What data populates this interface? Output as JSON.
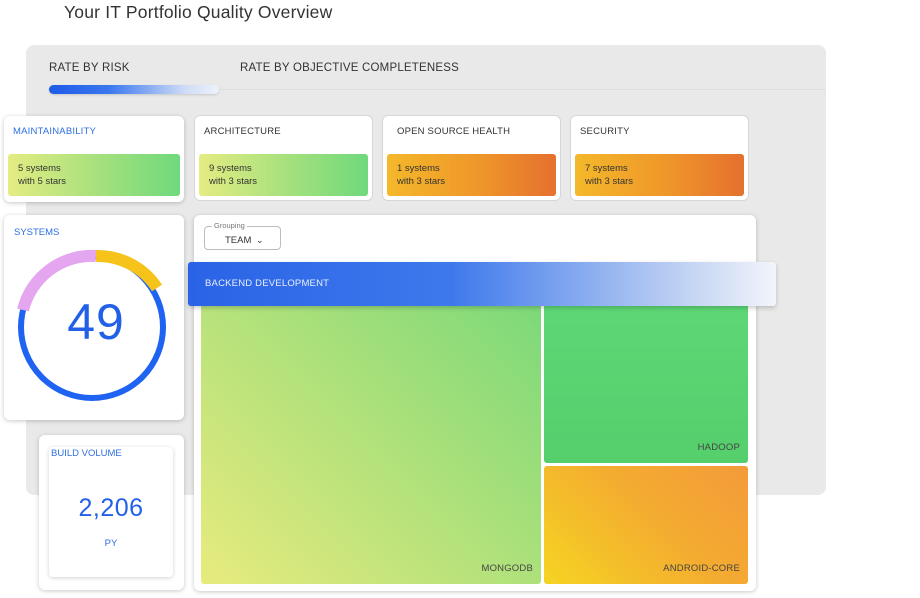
{
  "page_title": "Your IT Portfolio Quality Overview",
  "tabs": [
    {
      "label": "RATE BY RISK",
      "active": true
    },
    {
      "label": "RATE BY OBJECTIVE COMPLETENESS",
      "active": false
    }
  ],
  "categories": [
    {
      "title": "MAINTAINABILITY",
      "line1": "5 systems",
      "line2": "with 5 stars",
      "tone": "green"
    },
    {
      "title": "ARCHITECTURE",
      "line1": "9 systems",
      "line2": "with 3 stars",
      "tone": "green"
    },
    {
      "title": "OPEN SOURCE HEALTH",
      "line1": "1 systems",
      "line2": "with 3 stars",
      "tone": "orange"
    },
    {
      "title": "SECURITY",
      "line1": "7 systems",
      "line2": "with 3 stars",
      "tone": "orange"
    }
  ],
  "systems": {
    "label": "SYSTEMS",
    "count": "49",
    "gauge_colors": {
      "track": "#1f63f2",
      "segment_pink": "#e4a6ef",
      "segment_yellow": "#f5c31a"
    }
  },
  "build_volume": {
    "label": "BUILD VOLUME",
    "value": "2,206",
    "unit": "PY"
  },
  "grouping": {
    "legend": "Grouping",
    "value": "TEAM",
    "icon": "chevron-down-icon"
  },
  "treemap": {
    "group_label": "BACKEND DEVELOPMENT",
    "tiles": [
      {
        "label": "MONGODB",
        "tone": "green"
      },
      {
        "label": "HADOOP",
        "tone": "green"
      },
      {
        "label": "ANDROID-CORE",
        "tone": "orange"
      }
    ]
  },
  "colors": {
    "accent": "#2260e8",
    "green": "#6fd97c",
    "orange": "#ef962a"
  }
}
